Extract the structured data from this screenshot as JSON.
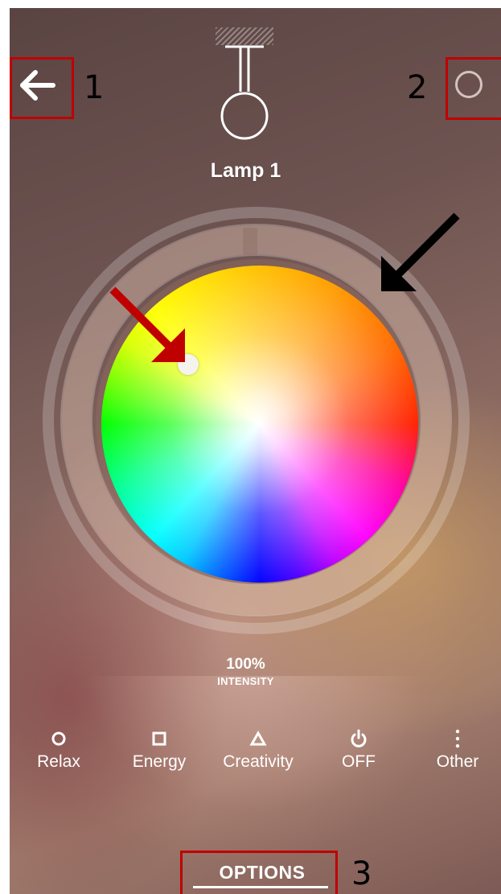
{
  "lamp": {
    "name": "Lamp 1"
  },
  "navigation": {
    "back_icon": "back-arrow-icon",
    "power_icon": "power-ring-icon"
  },
  "color_wheel": {
    "selected_color": "#f5f3ee",
    "ring_marker": "intensity-marker"
  },
  "intensity": {
    "value": "100%",
    "label": "INTENSITY"
  },
  "modes": [
    {
      "label": "Relax",
      "icon": "circle-icon"
    },
    {
      "label": "Energy",
      "icon": "square-icon"
    },
    {
      "label": "Creativity",
      "icon": "triangle-icon"
    },
    {
      "label": "OFF",
      "icon": "power-icon"
    },
    {
      "label": "Other",
      "icon": "more-vertical-icon"
    }
  ],
  "footer": {
    "options_label": "OPTIONS"
  },
  "annotations": {
    "one": "1",
    "two": "2",
    "three": "3"
  },
  "colors": {
    "annotation_red": "#c00000",
    "text": "#ffffff"
  }
}
